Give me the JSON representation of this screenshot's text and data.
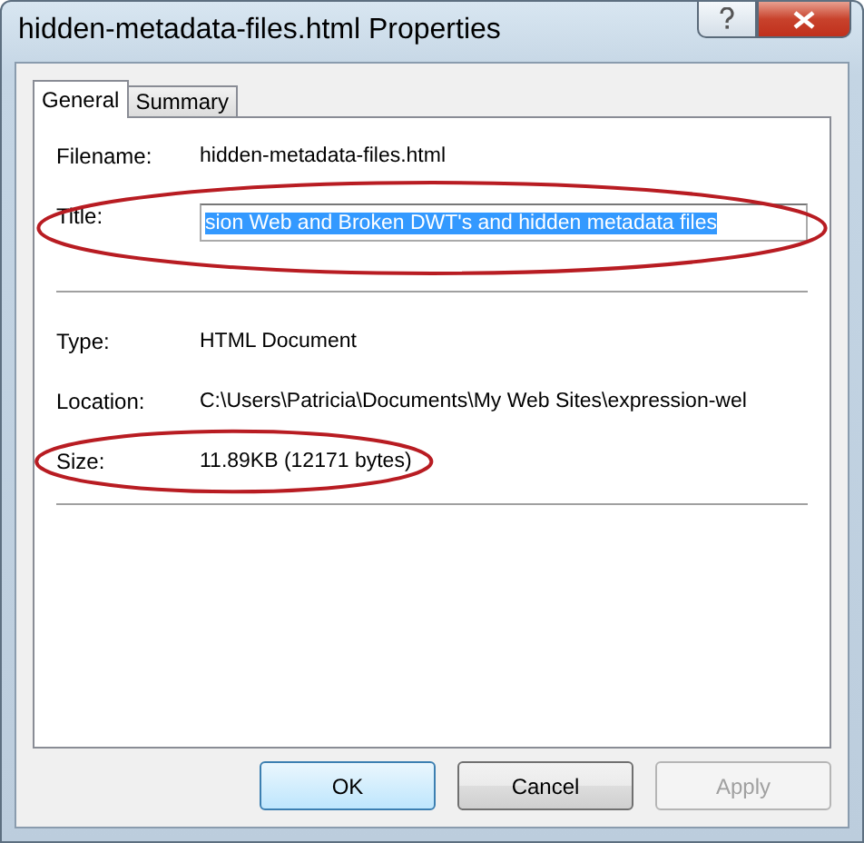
{
  "window": {
    "title": "hidden-metadata-files.html Properties"
  },
  "tabs": [
    {
      "label": "General",
      "selected": true
    },
    {
      "label": "Summary",
      "selected": false
    }
  ],
  "sections": [
    {
      "rows": [
        {
          "kind": "text",
          "label": "Filename:",
          "value": "hidden-metadata-files.html",
          "circled": false
        },
        {
          "kind": "field",
          "label": "Title:",
          "value": "sion Web and Broken DWT's and hidden metadata files",
          "text_selected": true,
          "circled": true
        }
      ]
    },
    {
      "rows": [
        {
          "kind": "text",
          "label": "Type:",
          "value": "HTML Document",
          "circled": false
        },
        {
          "kind": "text",
          "label": "Location:",
          "value": "C:\\Users\\Patricia\\Documents\\My Web Sites\\expression-wel",
          "circled": false
        },
        {
          "kind": "text",
          "label": "Size:",
          "value": "11.89KB (12171 bytes)",
          "circled": true
        }
      ]
    }
  ],
  "buttons": [
    {
      "label": "OK",
      "default": true,
      "disabled": false
    },
    {
      "label": "Cancel",
      "default": false,
      "disabled": false
    },
    {
      "label": "Apply",
      "default": false,
      "disabled": true
    }
  ]
}
